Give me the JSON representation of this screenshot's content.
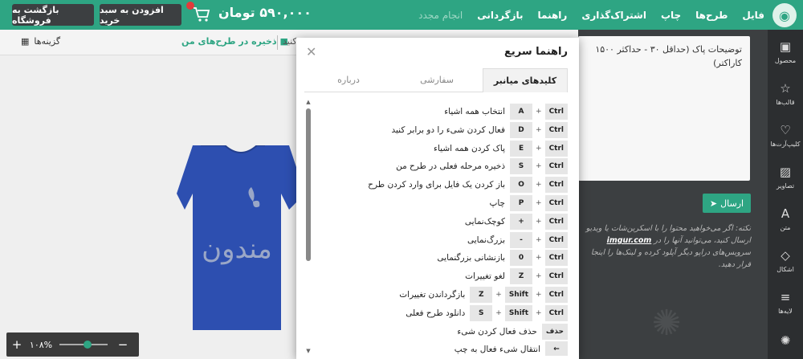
{
  "topbar": {
    "nav": [
      "فایل",
      "طرح‌ها",
      "چاپ",
      "اشتراک‌گذاری",
      "راهنما",
      "بازگردانی",
      "انجام مجدد"
    ],
    "price": "۵۹۰,۰۰۰ تومان",
    "add_to_cart": "افزودن به سبد خرید",
    "back_to_store": "بازگشت به فروشگاه"
  },
  "toolbar": {
    "options": "گزینه‌ها",
    "save_in_designs": "ذخیره در طرح‌های من",
    "cut_text": "کنید"
  },
  "zoom": {
    "value": "۱۰۸%",
    "level_percent": 60
  },
  "right_panel": {
    "description_placeholder": "توضیحات پاک (حداقل ۳۰ - حداکثر ۱۵۰۰ کاراکتر)",
    "send_label": "ارسال",
    "note_text_1": "نکته: اگر می‌خواهید محتوا را با اسکرین‌شات یا ویدیو ارسال کنید، می‌توانید آنها را در ",
    "note_link": "imgur.com",
    "note_text_2": " سرویس‌های دراپو دیگر آپلود کرده و لینک‌ها را اینجا قرار دهید."
  },
  "sidebar": [
    {
      "label": "محصول",
      "icon": "shirt-icon",
      "glyph": "▣"
    },
    {
      "label": "قالب‌ها",
      "icon": "star-icon",
      "glyph": "☆"
    },
    {
      "label": "کلیپ‌آرت‌ها",
      "icon": "heart-icon",
      "glyph": "♡"
    },
    {
      "label": "تصاویر",
      "icon": "image-icon",
      "glyph": "▨"
    },
    {
      "label": "متن",
      "icon": "text-icon",
      "glyph": "A"
    },
    {
      "label": "اشکال",
      "icon": "diamond-icon",
      "glyph": "◇"
    },
    {
      "label": "لایه‌ها",
      "icon": "layers-icon",
      "glyph": "≡"
    }
  ],
  "canvas": {
    "design_text": "مندون"
  },
  "dialog": {
    "title": "راهنما سریع",
    "tabs": [
      "کلیدهای میانبر",
      "سفارشی",
      "درباره"
    ],
    "shortcuts": [
      {
        "keys": [
          "Ctrl",
          "A"
        ],
        "desc": "انتخاب همه اشیاء"
      },
      {
        "keys": [
          "Ctrl",
          "D"
        ],
        "desc": "فعال کردن شیء را دو برابر کنید"
      },
      {
        "keys": [
          "Ctrl",
          "E"
        ],
        "desc": "پاک کردن همه اشیاء"
      },
      {
        "keys": [
          "Ctrl",
          "S"
        ],
        "desc": "ذخیره مرحله فعلی در طرح من"
      },
      {
        "keys": [
          "Ctrl",
          "O"
        ],
        "desc": "باز کردن یک فایل برای وارد کردن طرح"
      },
      {
        "keys": [
          "Ctrl",
          "P"
        ],
        "desc": "چاپ"
      },
      {
        "keys": [
          "Ctrl",
          "+"
        ],
        "desc": "کوچک‌نمایی"
      },
      {
        "keys": [
          "Ctrl",
          "-"
        ],
        "desc": "بزرگ‌نمایی"
      },
      {
        "keys": [
          "Ctrl",
          "0"
        ],
        "desc": "بازنشانی بزرگنمایی"
      },
      {
        "keys": [
          "Ctrl",
          "Z"
        ],
        "desc": "لغو تغییرات"
      },
      {
        "keys": [
          "Ctrl",
          "Shift",
          "Z"
        ],
        "desc": "بازگرداندن تغییرات"
      },
      {
        "keys": [
          "Ctrl",
          "Shift",
          "S"
        ],
        "desc": "دانلود طرح فعلی"
      },
      {
        "keys": [
          "حذف"
        ],
        "desc": "حذف فعال کردن شیء"
      },
      {
        "keys": [
          "←"
        ],
        "desc": "انتقال شیء فعال به چپ"
      }
    ]
  },
  "colors": {
    "brand": "#2ea583",
    "dark": "#3c3f41",
    "shirt": "#2d4fb0"
  }
}
